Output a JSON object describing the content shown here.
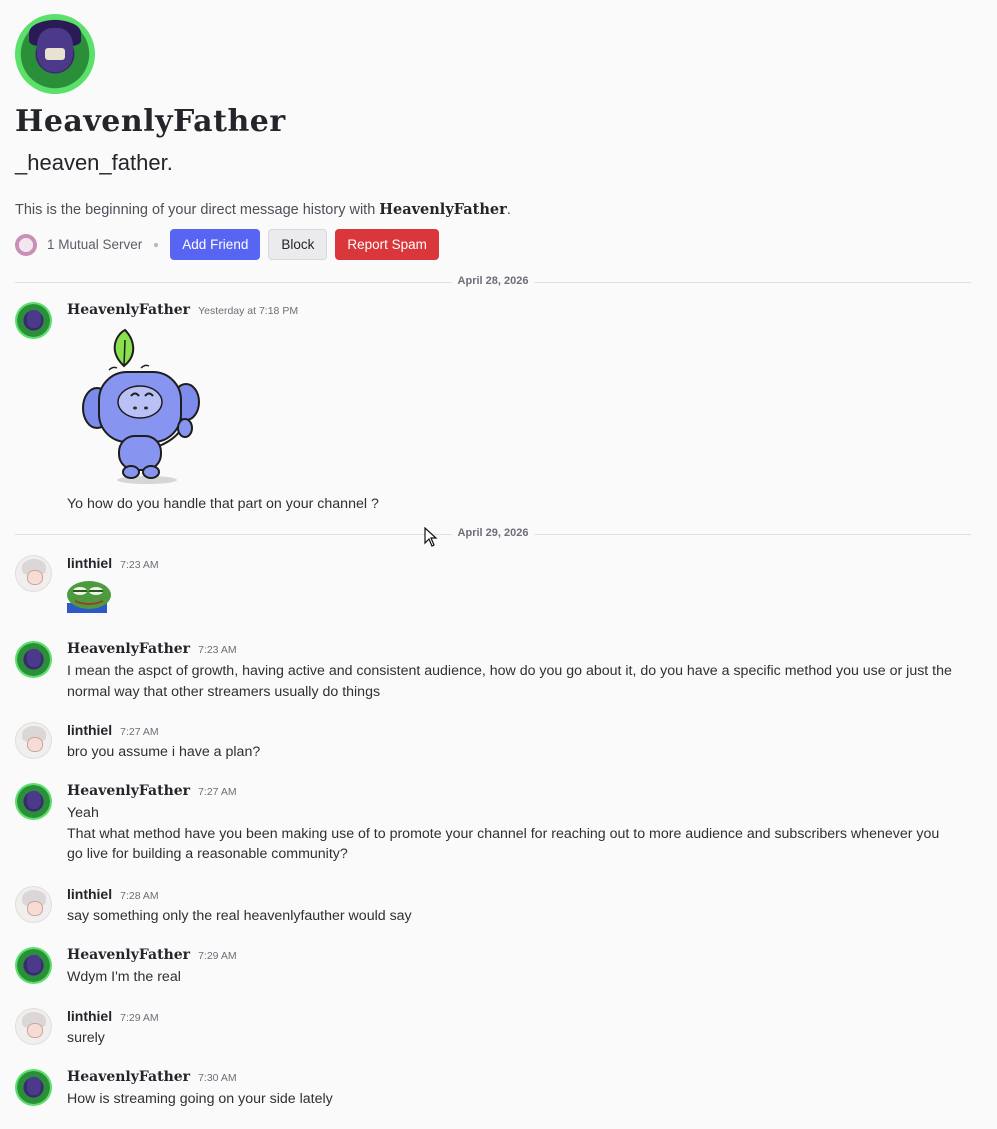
{
  "profile": {
    "display_name": "HeavenlyFather",
    "username": "_heaven_father.",
    "history_prefix": "This is the beginning of your direct message history with ",
    "history_name": "HeavenlyFather",
    "history_suffix": ".",
    "mutual_servers": "1 Mutual Server",
    "buttons": {
      "add_friend": "Add Friend",
      "block": "Block",
      "report_spam": "Report Spam"
    }
  },
  "dividers": [
    "April 28, 2026",
    "April 29, 2026"
  ],
  "messages": [
    {
      "author": "HeavenlyFather",
      "time": "Yesterday at 7:18 PM",
      "text": "Yo how do you handle that part on your channel ?"
    },
    {
      "author": "linthiel",
      "time": "7:23 AM",
      "text": ""
    },
    {
      "author": "HeavenlyFather",
      "time": "7:23 AM",
      "text": "I mean the aspct of growth, having active and consistent audience, how do you go about it, do you have a specific method you use or just the normal way that other streamers usually do things"
    },
    {
      "author": "linthiel",
      "time": "7:27 AM",
      "text": "bro you assume i have a plan?"
    },
    {
      "author": "HeavenlyFather",
      "time": "7:27 AM",
      "text": "Yeah",
      "text2": "That what method have you been making use of to promote your channel for reaching out to more audience and subscribers whenever you go live for building a reasonable community?"
    },
    {
      "author": "linthiel",
      "time": "7:28 AM",
      "text": "say something only the real heavenlyfauther would say"
    },
    {
      "author": "HeavenlyFather",
      "time": "7:29 AM",
      "text": "Wdym I'm the real"
    },
    {
      "author": "linthiel",
      "time": "7:29 AM",
      "text": "surely"
    },
    {
      "author": "HeavenlyFather",
      "time": "7:30 AM",
      "text": "How is streaming going on your side lately"
    }
  ],
  "colors": {
    "blurple": "#5865f2",
    "danger": "#da373c",
    "background": "#fafafa"
  }
}
